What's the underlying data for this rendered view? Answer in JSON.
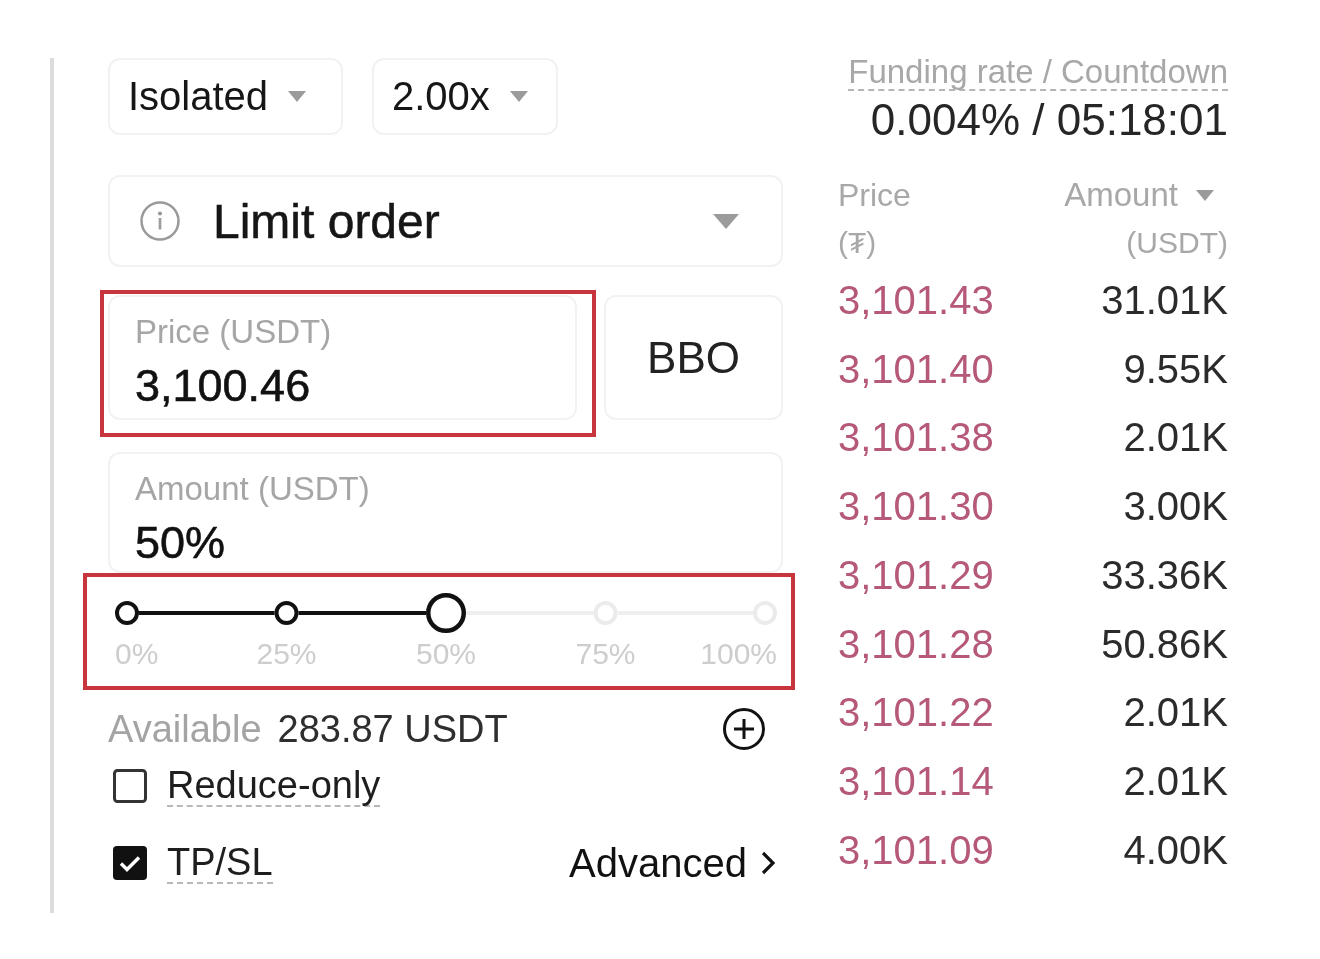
{
  "margin_mode": {
    "label": "Isolated"
  },
  "leverage": {
    "label": "2.00x"
  },
  "funding": {
    "label": "Funding rate / Countdown",
    "value": "0.004% / 05:18:01"
  },
  "order_type": {
    "label": "Limit order"
  },
  "price_field": {
    "label": "Price (USDT)",
    "value": "3,100.46",
    "highlighted": true
  },
  "bbo_button": {
    "label": "BBO"
  },
  "amount_field": {
    "label": "Amount (USDT)",
    "value": "50%"
  },
  "amount_slider": {
    "level": 0.5,
    "highlighted": true,
    "stops": [
      {
        "label": "0%"
      },
      {
        "label": "25%"
      },
      {
        "label": "50%"
      },
      {
        "label": "75%"
      },
      {
        "label": "100%"
      }
    ]
  },
  "available": {
    "label": "Available",
    "value": "283.87 USDT"
  },
  "options": [
    {
      "label": "Reduce-only",
      "checked": false
    },
    {
      "label": "TP/SL",
      "checked": true
    }
  ],
  "advanced_link": {
    "label": "Advanced"
  },
  "order_book": {
    "columns": [
      {
        "label": "Price",
        "unit": "(₮)",
        "dropdown": false
      },
      {
        "label": "Amount",
        "unit": "(USDT)",
        "dropdown": true
      }
    ],
    "rows": [
      {
        "price": "3,101.43",
        "amount": "31.01K"
      },
      {
        "price": "3,101.40",
        "amount": "9.55K"
      },
      {
        "price": "3,101.38",
        "amount": "2.01K"
      },
      {
        "price": "3,101.30",
        "amount": "3.00K"
      },
      {
        "price": "3,101.29",
        "amount": "33.36K"
      },
      {
        "price": "3,101.28",
        "amount": "50.86K"
      },
      {
        "price": "3,101.22",
        "amount": "2.01K"
      },
      {
        "price": "3,101.14",
        "amount": "2.01K"
      },
      {
        "price": "3,101.09",
        "amount": "4.00K"
      }
    ]
  }
}
